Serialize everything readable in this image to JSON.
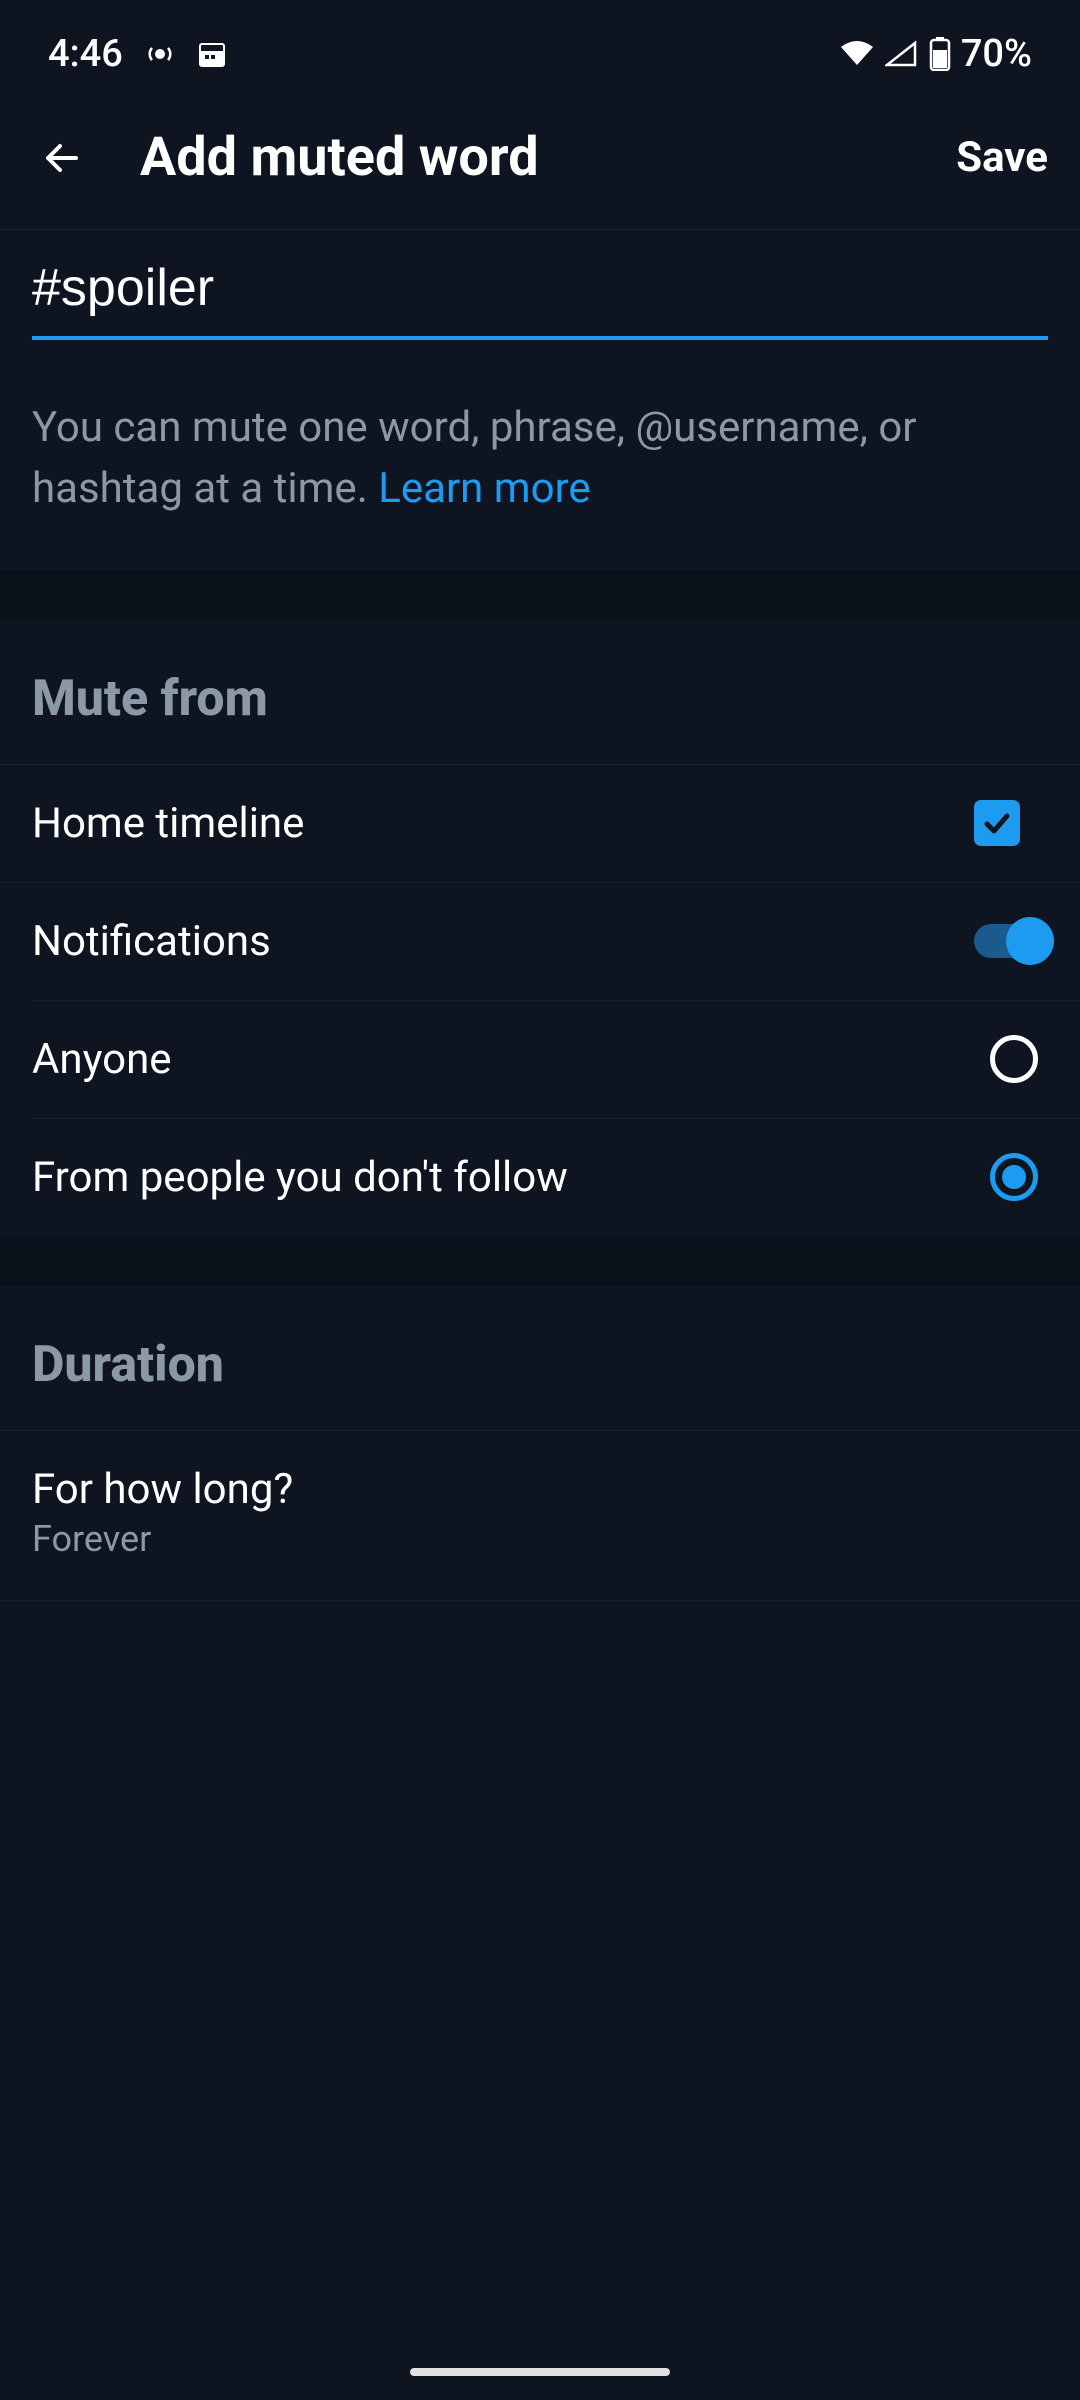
{
  "statusBar": {
    "time": "4:46",
    "battery": "70%"
  },
  "header": {
    "title": "Add muted word",
    "save": "Save"
  },
  "input": {
    "value": "#spoiler",
    "helpText": "You can mute one word, phrase, @username, or hashtag at a time. ",
    "learnMore": "Learn more"
  },
  "muteFrom": {
    "title": "Mute from",
    "homeTimeline": "Home timeline",
    "notifications": "Notifications",
    "anyone": "Anyone",
    "notFollow": "From people you don't follow"
  },
  "duration": {
    "title": "Duration",
    "label": "For how long?",
    "value": "Forever"
  }
}
